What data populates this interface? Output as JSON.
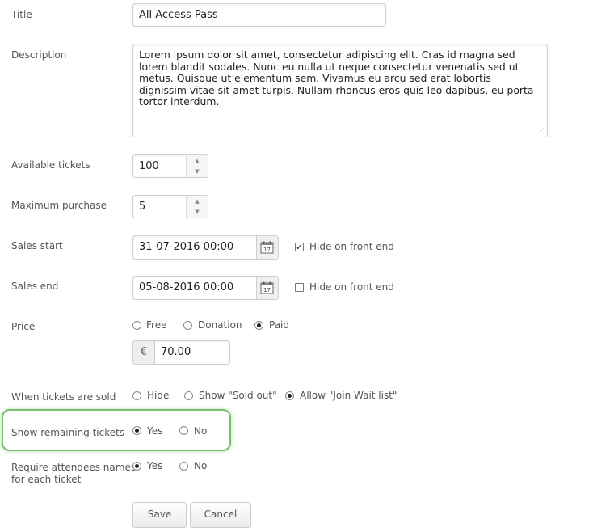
{
  "form": {
    "title": {
      "label": "Title",
      "value": "All Access Pass"
    },
    "description": {
      "label": "Description",
      "value": "Lorem ipsum dolor sit amet, consectetur adipiscing elit. Cras id magna sed lorem blandit sodales. Nunc eu nulla ut neque consectetur venenatis sed ut metus. Quisque ut elementum sem. Vivamus eu arcu sed erat lobortis dignissim vitae sit amet turpis. Nullam rhoncus eros quis leo dapibus, eu porta tortor interdum."
    },
    "available_tickets": {
      "label": "Available tickets",
      "value": "100"
    },
    "maximum_purchase": {
      "label": "Maximum purchase",
      "value": "5"
    },
    "sales_start": {
      "label": "Sales start",
      "value": "31-07-2016 00:00",
      "hide_label": "Hide on front end",
      "hide_checked": true
    },
    "sales_end": {
      "label": "Sales end",
      "value": "05-08-2016 00:00",
      "hide_label": "Hide on front end",
      "hide_checked": false
    },
    "price": {
      "label": "Price",
      "options": [
        "Free",
        "Donation",
        "Paid"
      ],
      "selected": "Paid",
      "currency_symbol": "€",
      "amount": "70.00"
    },
    "when_sold": {
      "label": "When tickets are sold",
      "options": [
        "Hide",
        "Show \"Sold out\"",
        "Allow \"Join Wait list\""
      ],
      "selected": "Allow \"Join Wait list\""
    },
    "show_remaining": {
      "label": "Show remaining tickets",
      "options": [
        "Yes",
        "No"
      ],
      "selected": "Yes"
    },
    "require_names": {
      "label_line1": "Require attendees names",
      "label_line2": "for each ticket",
      "options": [
        "Yes",
        "No"
      ],
      "selected": "Yes"
    }
  },
  "buttons": {
    "save": "Save",
    "cancel": "Cancel"
  },
  "colors": {
    "highlight": "#74c26a"
  },
  "icons": {
    "calendar": "calendar-icon",
    "spinner": "spinner-arrows-icon"
  }
}
